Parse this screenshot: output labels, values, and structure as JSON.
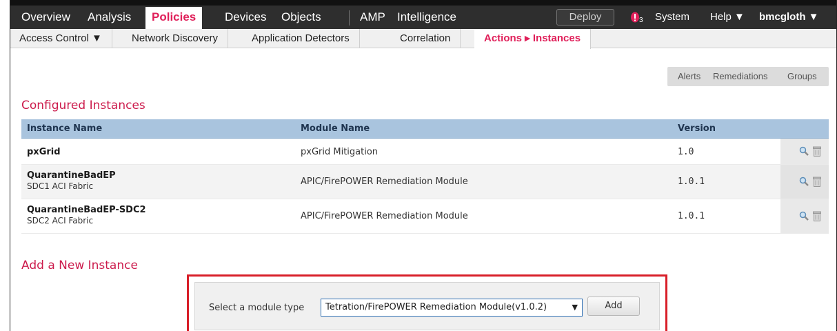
{
  "top_nav": {
    "items": [
      "Overview",
      "Analysis",
      "Policies",
      "Devices",
      "Objects",
      "AMP",
      "Intelligence"
    ],
    "active": "Policies",
    "deploy_label": "Deploy",
    "alert_count": "3",
    "system_label": "System",
    "help_label": "Help ▼",
    "user_label": "bmcgloth ▼"
  },
  "sub_nav": {
    "tabs": [
      "Access Control ▼",
      "Network Discovery",
      "Application Detectors",
      "Correlation",
      "Actions ▸ Instances"
    ],
    "active": "Actions ▸ Instances"
  },
  "action_links": [
    "Alerts",
    "Remediations",
    "Groups"
  ],
  "configured": {
    "title": "Configured Instances",
    "columns": [
      "Instance Name",
      "Module Name",
      "Version"
    ],
    "rows": [
      {
        "name": "pxGrid",
        "subtitle": "",
        "module": "pxGrid Mitigation",
        "version": "1.0"
      },
      {
        "name": "QuarantineBadEP",
        "subtitle": "SDC1 ACI Fabric",
        "module": "APIC/FirePOWER Remediation Module",
        "version": "1.0.1"
      },
      {
        "name": "QuarantineBadEP-SDC2",
        "subtitle": "SDC2 ACI Fabric",
        "module": "APIC/FirePOWER Remediation Module",
        "version": "1.0.1"
      }
    ]
  },
  "add_instance": {
    "title": "Add a New Instance",
    "label": "Select a module type",
    "selected_module": "Tetration/FirePOWER Remediation Module(v1.0.2)",
    "add_label": "Add"
  },
  "colors": {
    "accent": "#e0205a",
    "nav_bg": "#2e2e2e",
    "header_bg": "#a9c4de",
    "highlight_border": "#d81e28"
  },
  "icons": [
    "alert-icon",
    "search-icon",
    "trash-icon"
  ]
}
